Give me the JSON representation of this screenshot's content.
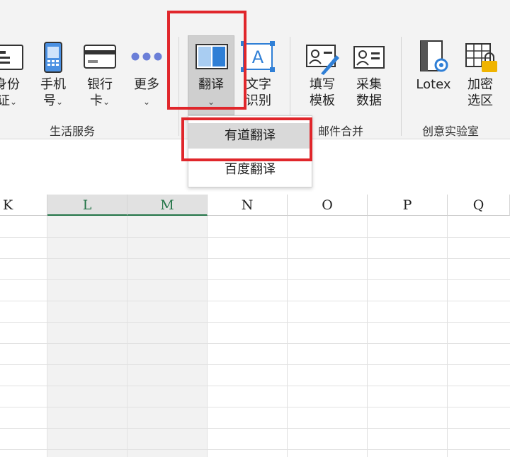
{
  "ribbon": {
    "groups": {
      "life_services": "生活服务",
      "mail_merge": "邮件合并",
      "creative_lab": "创意实验室"
    },
    "items": {
      "id_card": {
        "line1": "身份",
        "line2": "证",
        "icon": "id-card-icon"
      },
      "phone": {
        "line1": "手机",
        "line2": "号",
        "icon": "phone-icon"
      },
      "bank": {
        "line1": "银行",
        "line2": "卡",
        "icon": "bank-card-icon"
      },
      "more": {
        "line1": "更多",
        "icon": "more-dots-icon"
      },
      "translate": {
        "line1": "翻译",
        "icon": "translate-icon"
      },
      "ocr": {
        "line1": "文字",
        "line2": "识别",
        "icon": "text-recognition-icon"
      },
      "fill_template": {
        "line1": "填写",
        "line2": "模板",
        "icon": "fill-template-icon"
      },
      "collect_data": {
        "line1": "采集",
        "line2": "数据",
        "icon": "collect-data-icon"
      },
      "lotex": {
        "line1": "Lotex",
        "icon": "lotex-icon"
      },
      "encrypt": {
        "line1": "加密",
        "line2": "选区",
        "icon": "encrypt-range-icon"
      }
    },
    "chevron": "⌄"
  },
  "dropdown": {
    "items": [
      "有道翻译",
      "百度翻译"
    ]
  },
  "grid": {
    "columns": [
      "K",
      "L",
      "M",
      "N",
      "O",
      "P",
      "Q"
    ]
  },
  "colors": {
    "annotation_red": "#e0262b",
    "accent_blue": "#2f7fd6",
    "excel_green": "#217346",
    "ribbon_bg": "#f3f3f3"
  }
}
